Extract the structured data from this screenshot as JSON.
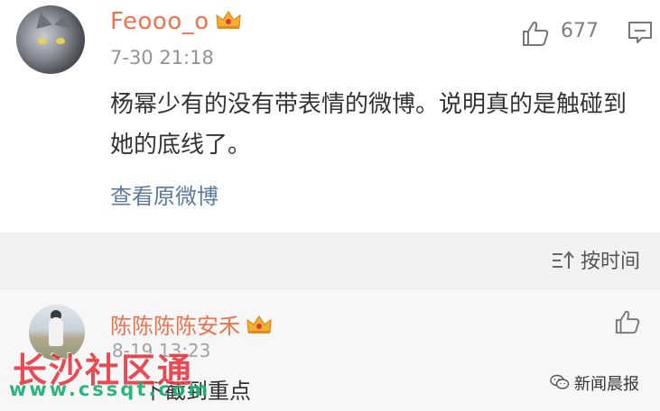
{
  "post": {
    "author": "Feooo_o",
    "time": "7-30 21:18",
    "like_count": "677",
    "text": "杨幂少有的没有带表情的微博。说明真的是触碰到她的底线了。",
    "view_original": "查看原微博"
  },
  "sort": {
    "label": "按时间"
  },
  "comment": {
    "author": "陈陈陈陈安禾",
    "time": "8-19 13:23",
    "text": "下截到重点"
  },
  "watermark": {
    "logo": "长沙社区通",
    "url": "www.cssqt.com"
  },
  "source": {
    "label": "新闻晨报"
  },
  "colors": {
    "name": "#eb7350",
    "link": "#5d7a9e",
    "crown": "#f0b030",
    "watermark_red": "#e8343f",
    "watermark_green": "#16b070"
  }
}
